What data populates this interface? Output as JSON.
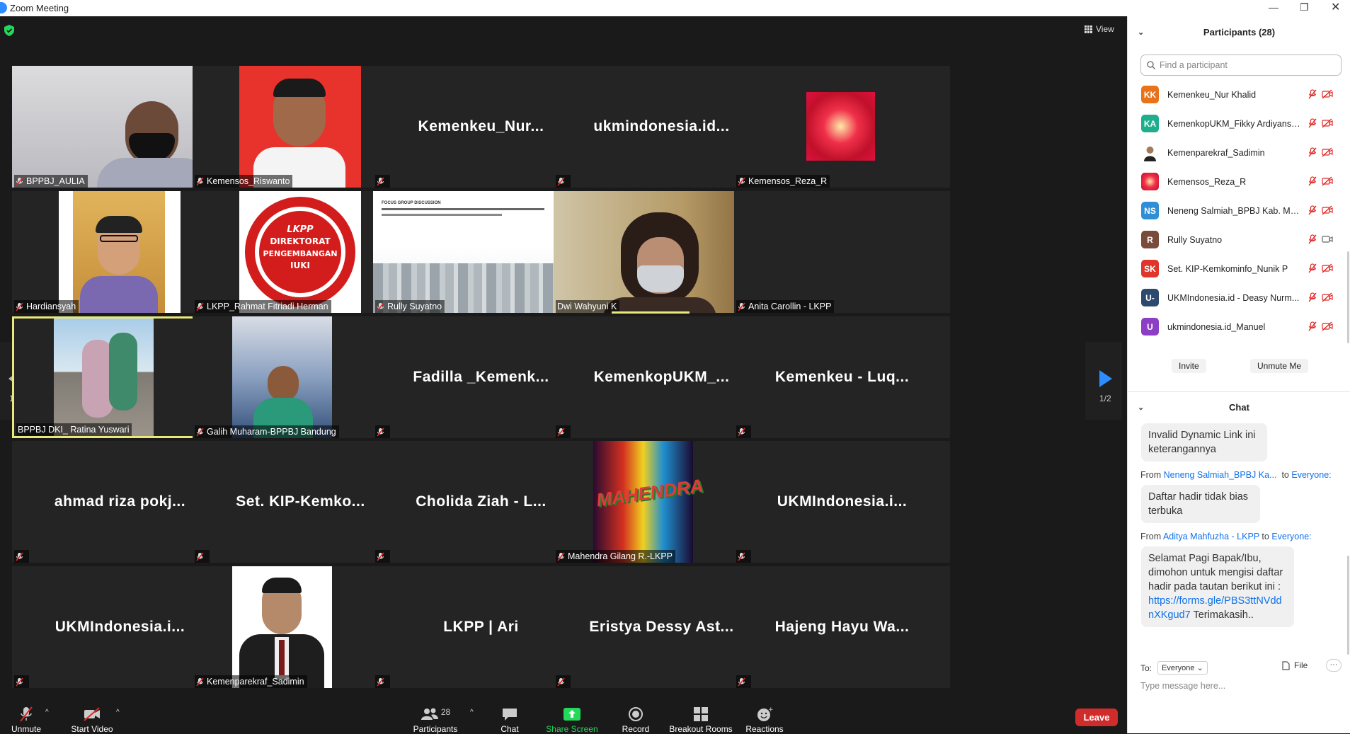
{
  "window": {
    "title": "Zoom Meeting"
  },
  "view": {
    "label": "View"
  },
  "pager": {
    "left": "1/2",
    "right": "1/2"
  },
  "tiles": [
    {
      "label": "BPPBJ_AULIA",
      "big": "",
      "muted": true
    },
    {
      "label": "Kemensos_Riswanto",
      "big": "",
      "muted": true
    },
    {
      "label": "",
      "big": "Kemenkeu_Nur...",
      "muted": true
    },
    {
      "label": "",
      "big": "ukmindonesia.id...",
      "muted": true
    },
    {
      "label": "Kemensos_Reza_R",
      "big": "",
      "muted": true
    },
    {
      "label": "Hardiansyah",
      "big": "",
      "muted": true
    },
    {
      "label": "LKPP_Rahmat Fitriadi Herman",
      "big": "",
      "muted": true
    },
    {
      "label": "Rully Suyatno",
      "big": "",
      "muted": true
    },
    {
      "label": "Dwi Wahyuni K",
      "big": "",
      "muted": false
    },
    {
      "label": "Anita Carollin - LKPP",
      "big": "",
      "muted": true
    },
    {
      "label": "BPPBJ DKI_ Ratina Yuswari",
      "big": "",
      "muted": false
    },
    {
      "label": "Galih Muharam-BPPBJ Bandung",
      "big": "",
      "muted": true
    },
    {
      "label": "",
      "big": "Fadilla _Kemenk...",
      "muted": true
    },
    {
      "label": "",
      "big": "KemenkopUKM_...",
      "muted": true
    },
    {
      "label": "",
      "big": "Kemenkeu - Luq...",
      "muted": true
    },
    {
      "label": "",
      "big": "ahmad riza pokj...",
      "muted": true
    },
    {
      "label": "",
      "big": "Set. KIP-Kemko...",
      "muted": true
    },
    {
      "label": "",
      "big": "Cholida Ziah - L...",
      "muted": true
    },
    {
      "label": "Mahendra Gilang R.-LKPP",
      "big": "",
      "muted": true
    },
    {
      "label": "",
      "big": "UKMIndonesia.i...",
      "muted": true
    },
    {
      "label": "",
      "big": "UKMIndonesia.i...",
      "muted": true
    },
    {
      "label": "Kemenparekraf_Sadimin",
      "big": "",
      "muted": true
    },
    {
      "label": "",
      "big": "LKPP | Ari",
      "muted": true
    },
    {
      "label": "",
      "big": "Eristya Dessy Ast...",
      "muted": true
    },
    {
      "label": "",
      "big": "Hajeng Hayu Wa...",
      "muted": true
    }
  ],
  "tile_text": {
    "lkpp_logo": "LKPP",
    "lkpp_line1": "DIREKTORAT",
    "lkpp_line2": "PENGEMBANGAN",
    "lkpp_line3": "IUKI",
    "slide_title": "FOCUS GROUP DISCUSSION",
    "mahendra_art": "MAHENDRA"
  },
  "toolbar": {
    "unmute": "Unmute",
    "start_video": "Start Video",
    "participants": "Participants",
    "participants_count": "28",
    "chat": "Chat",
    "share_screen": "Share Screen",
    "record": "Record",
    "breakout": "Breakout Rooms",
    "reactions": "Reactions",
    "leave": "Leave"
  },
  "participants_panel": {
    "title": "Participants (28)",
    "search_placeholder": "Find a participant",
    "invite": "Invite",
    "unmute_me": "Unmute Me",
    "items": [
      {
        "initials": "KK",
        "color": "#e8731a",
        "name": "Kemenkeu_Nur Khalid"
      },
      {
        "initials": "KA",
        "color": "#1fae8b",
        "name": "KemenkopUKM_Fikky Ardiyansy..."
      },
      {
        "initials": "",
        "color": "#ffffff",
        "name": "Kemenparekraf_Sadimin"
      },
      {
        "initials": "",
        "color": "#e0324b",
        "name": "Kemensos_Reza_R"
      },
      {
        "initials": "NS",
        "color": "#2f8fd6",
        "name": "Neneng Salmiah_BPBJ Kab. Ma..."
      },
      {
        "initials": "R",
        "color": "#7a4a3a",
        "name": "Rully Suyatno"
      },
      {
        "initials": "SK",
        "color": "#e0352b",
        "name": "Set. KIP-Kemkominfo_Nunik P"
      },
      {
        "initials": "U-",
        "color": "#2c4a6e",
        "name": "UKMIndonesia.id - Deasy Nurm..."
      },
      {
        "initials": "U",
        "color": "#8c3fc4",
        "name": "ukmindonesia.id_Manuel"
      }
    ]
  },
  "chat_panel": {
    "title": "Chat",
    "msg1": "Invalid Dynamic Link ini keterangannya",
    "from1_prefix": "From",
    "from1_name": "Neneng Salmiah_BPBJ Ka...",
    "to_word": "to",
    "to_target": "Everyone:",
    "msg2": "Daftar hadir tidak bias terbuka",
    "from2_name": "Aditya Mahfuzha - LKPP",
    "msg3": "Selamat Pagi Bapak/Ibu, dimohon untuk mengisi daftar hadir pada tautan berikut ini :",
    "msg3_link": "https://forms.gle/PBS3ttNVddnXKgud7",
    "msg3_tail": "Terimakasih..",
    "to_label": "To:",
    "to_select": "Everyone",
    "file": "File",
    "input_placeholder": "Type message here..."
  }
}
